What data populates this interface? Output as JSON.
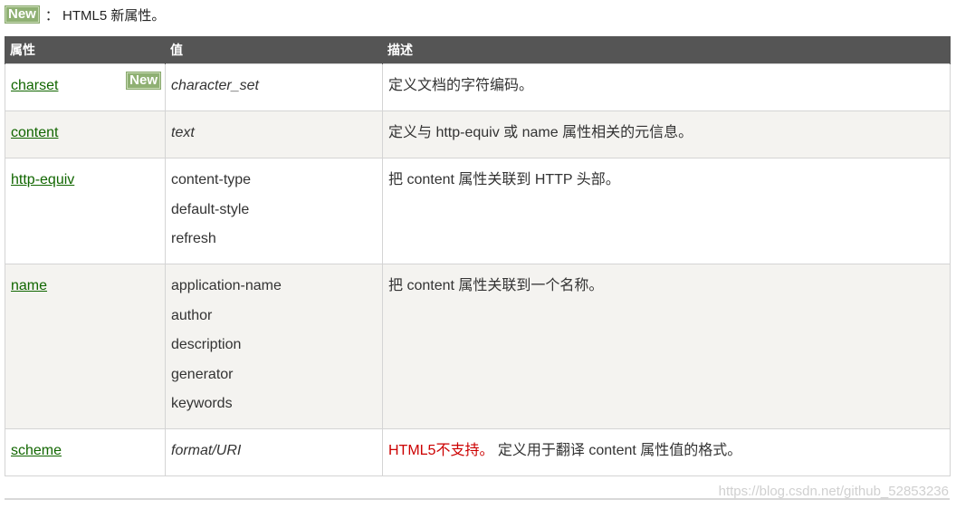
{
  "legend": {
    "badge": "New",
    "text": "： HTML5 新属性。"
  },
  "table": {
    "headers": [
      "属性",
      "值",
      "描述"
    ],
    "rows": [
      {
        "attribute": "charset",
        "is_new": true,
        "badge": "New",
        "values": [
          "character_set"
        ],
        "values_italic": true,
        "description_prefix": "",
        "description": "定义文档的字符编码。"
      },
      {
        "attribute": "content",
        "is_new": false,
        "values": [
          "text"
        ],
        "values_italic": true,
        "description_prefix": "",
        "description": "定义与 http-equiv 或 name 属性相关的元信息。"
      },
      {
        "attribute": "http-equiv",
        "is_new": false,
        "values": [
          "content-type",
          "default-style",
          "refresh"
        ],
        "values_italic": false,
        "description_prefix": "",
        "description": "把 content 属性关联到 HTTP 头部。"
      },
      {
        "attribute": "name",
        "is_new": false,
        "values": [
          "application-name",
          "author",
          "description",
          "generator",
          "keywords"
        ],
        "values_italic": false,
        "description_prefix": "",
        "description": "把 content 属性关联到一个名称。"
      },
      {
        "attribute": "scheme",
        "is_new": false,
        "values": [
          "format/URI"
        ],
        "values_italic": true,
        "description_prefix": "HTML5不支持。",
        "description": " 定义用于翻译 content 属性值的格式。"
      }
    ]
  },
  "watermark": "https://blog.csdn.net/github_52853236",
  "colors": {
    "header_bg": "#555555",
    "alt_row_bg": "#f4f3f0",
    "link": "#116600",
    "badge_bg": "#8fb073",
    "unsupported": "#cc0000"
  }
}
